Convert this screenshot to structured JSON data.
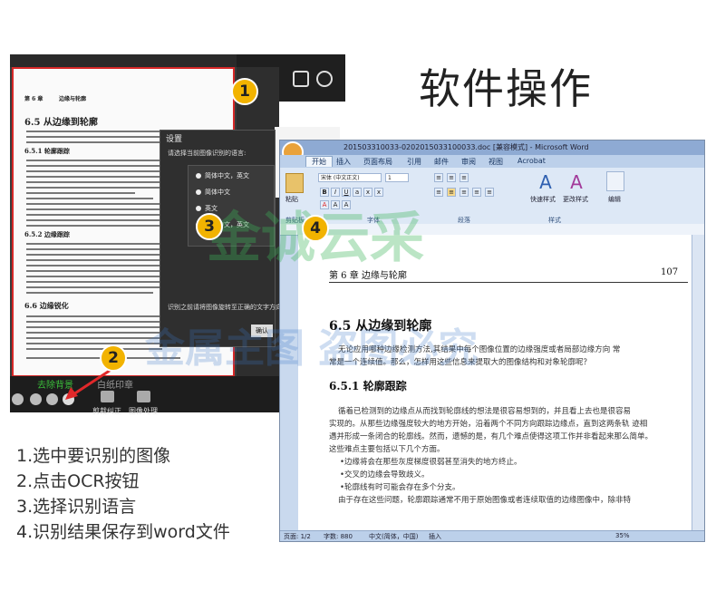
{
  "heading": "软件操作",
  "steps": [
    "1.选中要识别的图像",
    "2.点击OCR按钮",
    "3.选择识别语言",
    "4.识别结果保存到word文件"
  ],
  "badges": [
    "1",
    "2",
    "3",
    "4"
  ],
  "scanner": {
    "doc_header_left": "第 6 章",
    "doc_header_title": "边缘与轮廓",
    "doc_section_title": "6.5  从边缘到轮廓",
    "doc_sub1": "6.5.1  轮廓跟踪",
    "doc_sub2": "6.5.2  边缘跟踪",
    "doc_sub3": "6.6  边缘锐化",
    "tab_active": "去除背景",
    "tab_inactive": "白纸印章",
    "btn_crop": "剪裁纠正",
    "btn_process": "图像处理"
  },
  "dialog": {
    "title": "设置",
    "prompt": "请选择当前图像识别的语言:",
    "options": [
      "简体中文，英文",
      "简体中文",
      "英文",
      "繁体中文，英文"
    ],
    "auto_label": "识别之前请将图像旋转至正确的文字方向",
    "ok": "确认"
  },
  "word": {
    "window_title": "201503310033-0202015033100033.doc [兼容模式] - Microsoft Word",
    "office_button": "W",
    "tabs": [
      "开始",
      "插入",
      "页面布局",
      "引用",
      "邮件",
      "审阅",
      "视图",
      "Acrobat"
    ],
    "paste": "粘贴",
    "font_name": "宋体 (中文正文)",
    "font_size": "1",
    "fast_style": "快速样式",
    "change_style": "更改样式",
    "edit": "编辑",
    "groups": [
      "剪贴板",
      "字体",
      "段落",
      "样式"
    ],
    "chapter_header": "第 6 章 边缘与轮廓",
    "page_number": "107",
    "section": "6.5 从边缘到轮廓",
    "intro": [
      "无论应用哪种边缘检测方法,其结果中每个图像位置的边缘强度或者局部边缘方向 常",
      "常是一个连续值。那么，怎样用这些信息来提取大的图像结构和对象轮廓呢？"
    ],
    "subsection": "6.5.1 轮廓跟踪",
    "body": [
      "循着已检测到的边缘点从而找到轮廓线的想法是很容易想到的，并且看上去也是很容易",
      "实现的。从那些边缘强度较大的地方开始，沿着两个不同方向跟踪边缘点，直到这两条轨 迹相",
      "遇并形成一条闭合的轮廓线。然而，遗憾的是，有几个难点使得这项工作并非看起来那么简单。",
      "这些难点主要包括以下几个方面。",
      "•边缘将会在那些灰度梯度很弱甚至消失的地方终止。",
      "•交叉的边缘会导致歧义。",
      "•轮廓线有时可能会存在多个分支。",
      "由于存在这些问题，轮廓跟踪通常不用于原始图像或者连续取值的边缘图像中，除非特"
    ],
    "status_page": "页面: 1/2",
    "status_words": "字数: 880",
    "status_lang": "中文(简体，中国)",
    "status_insert": "插入",
    "zoom": "35%"
  },
  "watermark": {
    "line1": "金诚云采",
    "line2": "金属主图 盗图必究"
  },
  "colors": {
    "badge": "#f2b300",
    "accent_green": "#3bbf3b",
    "selection_red": "#d62828",
    "arrow_red": "#e0282a"
  }
}
